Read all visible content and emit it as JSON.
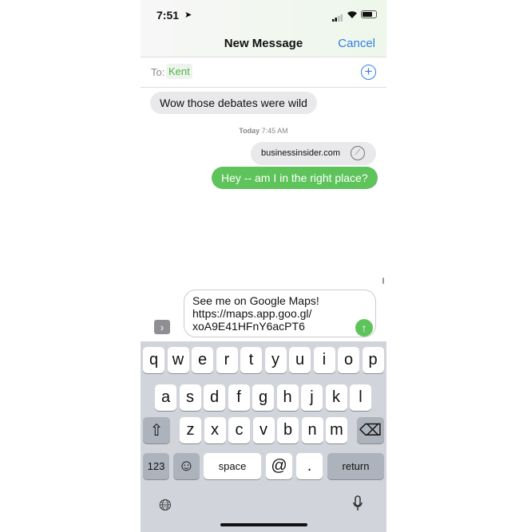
{
  "status": {
    "time": "7:51"
  },
  "header": {
    "title": "New Message",
    "cancel": "Cancel"
  },
  "to": {
    "label": "To:",
    "recipient": "Kent"
  },
  "messages": [
    {
      "text": "Wow those debates were wild",
      "from": "them"
    },
    {
      "timestamp_day": "Today",
      "timestamp_time": "7:45 AM"
    },
    {
      "text": "businessinsider.com",
      "type": "link"
    },
    {
      "text": "Hey -- am I in the right place?",
      "from": "me"
    }
  ],
  "compose": {
    "line1": "See me on Google Maps!",
    "line2": "https://maps.app.goo.gl/",
    "line3": "xoA9E41HFnY6acPT6"
  },
  "keyboard": {
    "row1": [
      "q",
      "w",
      "e",
      "r",
      "t",
      "y",
      "u",
      "i",
      "o",
      "p"
    ],
    "row2": [
      "a",
      "s",
      "d",
      "f",
      "g",
      "h",
      "j",
      "k",
      "l"
    ],
    "row3": [
      "z",
      "x",
      "c",
      "v",
      "b",
      "n",
      "m"
    ],
    "numbers": "123",
    "space": "space",
    "at": "@",
    "period": ".",
    "return": "return"
  },
  "colors": {
    "accent": "#2f7ee6",
    "sent_bubble": "#5ec35a",
    "received_bubble": "#e9e9eb"
  }
}
